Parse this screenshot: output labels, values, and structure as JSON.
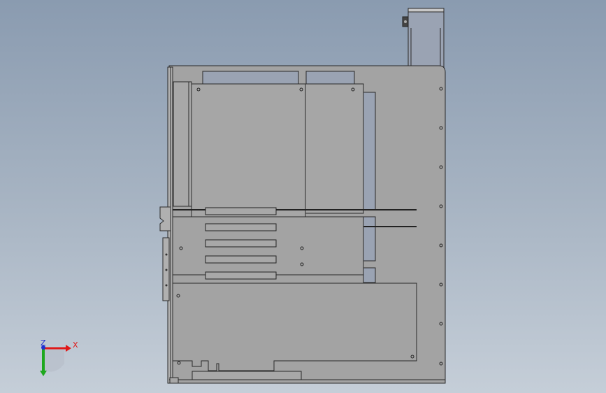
{
  "triad": {
    "x_label": "X",
    "z_label": "Z"
  },
  "colors": {
    "background_top": "#8a9bb0",
    "background_bottom": "#c5ced8",
    "panel_fill": "#a3a3a3",
    "panel_stroke": "#2a2a2a",
    "inset_fill": "#9aa3b3",
    "axis_x": "#e01818",
    "axis_y": "#1ea81e",
    "axis_z": "#2030d0"
  }
}
